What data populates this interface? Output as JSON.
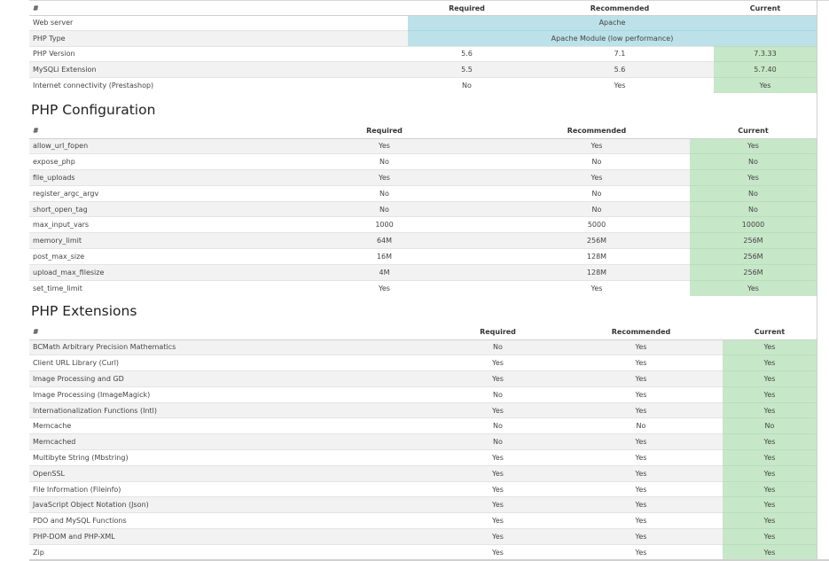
{
  "server": {
    "headers": [
      "#",
      "Required",
      "Recommended",
      "Current"
    ],
    "rows": [
      {
        "name": "Web server",
        "merged": "Apache"
      },
      {
        "name": "PHP Type",
        "merged": "Apache Module (low performance)"
      },
      {
        "name": "PHP Version",
        "required": "5.6",
        "recommended": "7.1",
        "current": "7.3.33"
      },
      {
        "name": "MySQLi Extension",
        "required": "5.5",
        "recommended": "5.6",
        "current": "5.7.40"
      },
      {
        "name": "Internet connectivity (Prestashop)",
        "required": "No",
        "recommended": "Yes",
        "current": "Yes"
      }
    ]
  },
  "php_config": {
    "title": "PHP Configuration",
    "headers": [
      "#",
      "Required",
      "Recommended",
      "Current"
    ],
    "rows": [
      {
        "name": "allow_url_fopen",
        "required": "Yes",
        "recommended": "Yes",
        "current": "Yes"
      },
      {
        "name": "expose_php",
        "required": "No",
        "recommended": "No",
        "current": "No"
      },
      {
        "name": "file_uploads",
        "required": "Yes",
        "recommended": "Yes",
        "current": "Yes"
      },
      {
        "name": "register_argc_argv",
        "required": "No",
        "recommended": "No",
        "current": "No"
      },
      {
        "name": "short_open_tag",
        "required": "No",
        "recommended": "No",
        "current": "No"
      },
      {
        "name": "max_input_vars",
        "required": "1000",
        "recommended": "5000",
        "current": "10000"
      },
      {
        "name": "memory_limit",
        "required": "64M",
        "recommended": "256M",
        "current": "256M"
      },
      {
        "name": "post_max_size",
        "required": "16M",
        "recommended": "128M",
        "current": "256M"
      },
      {
        "name": "upload_max_filesize",
        "required": "4M",
        "recommended": "128M",
        "current": "256M"
      },
      {
        "name": "set_time_limit",
        "required": "Yes",
        "recommended": "Yes",
        "current": "Yes"
      }
    ]
  },
  "php_ext": {
    "title": "PHP Extensions",
    "headers": [
      "#",
      "Required",
      "Recommended",
      "Current"
    ],
    "rows": [
      {
        "name": "BCMath Arbitrary Precision Mathematics",
        "required": "No",
        "recommended": "Yes",
        "current": "Yes"
      },
      {
        "name": "Client URL Library (Curl)",
        "required": "Yes",
        "recommended": "Yes",
        "current": "Yes"
      },
      {
        "name": "Image Processing and GD",
        "required": "Yes",
        "recommended": "Yes",
        "current": "Yes"
      },
      {
        "name": "Image Processing (ImageMagick)",
        "required": "No",
        "recommended": "Yes",
        "current": "Yes"
      },
      {
        "name": "Internationalization Functions (Intl)",
        "required": "Yes",
        "recommended": "Yes",
        "current": "Yes"
      },
      {
        "name": "Memcache",
        "required": "No",
        "recommended": "No",
        "current": "No"
      },
      {
        "name": "Memcached",
        "required": "No",
        "recommended": "Yes",
        "current": "Yes"
      },
      {
        "name": "Multibyte String (Mbstring)",
        "required": "Yes",
        "recommended": "Yes",
        "current": "Yes"
      },
      {
        "name": "OpenSSL",
        "required": "Yes",
        "recommended": "Yes",
        "current": "Yes"
      },
      {
        "name": "File Information (Fileinfo)",
        "required": "Yes",
        "recommended": "Yes",
        "current": "Yes"
      },
      {
        "name": "JavaScript Object Notation (Json)",
        "required": "Yes",
        "recommended": "Yes",
        "current": "Yes"
      },
      {
        "name": "PDO and MySQL Functions",
        "required": "Yes",
        "recommended": "Yes",
        "current": "Yes"
      },
      {
        "name": "PHP-DOM and PHP-XML",
        "required": "Yes",
        "recommended": "Yes",
        "current": "Yes"
      },
      {
        "name": "Zip",
        "required": "Yes",
        "recommended": "Yes",
        "current": "Yes"
      }
    ]
  },
  "colors": {
    "current_ok": "#c7e7c9",
    "info": "#bce1e8",
    "row_alt": "#f2f2f2"
  }
}
